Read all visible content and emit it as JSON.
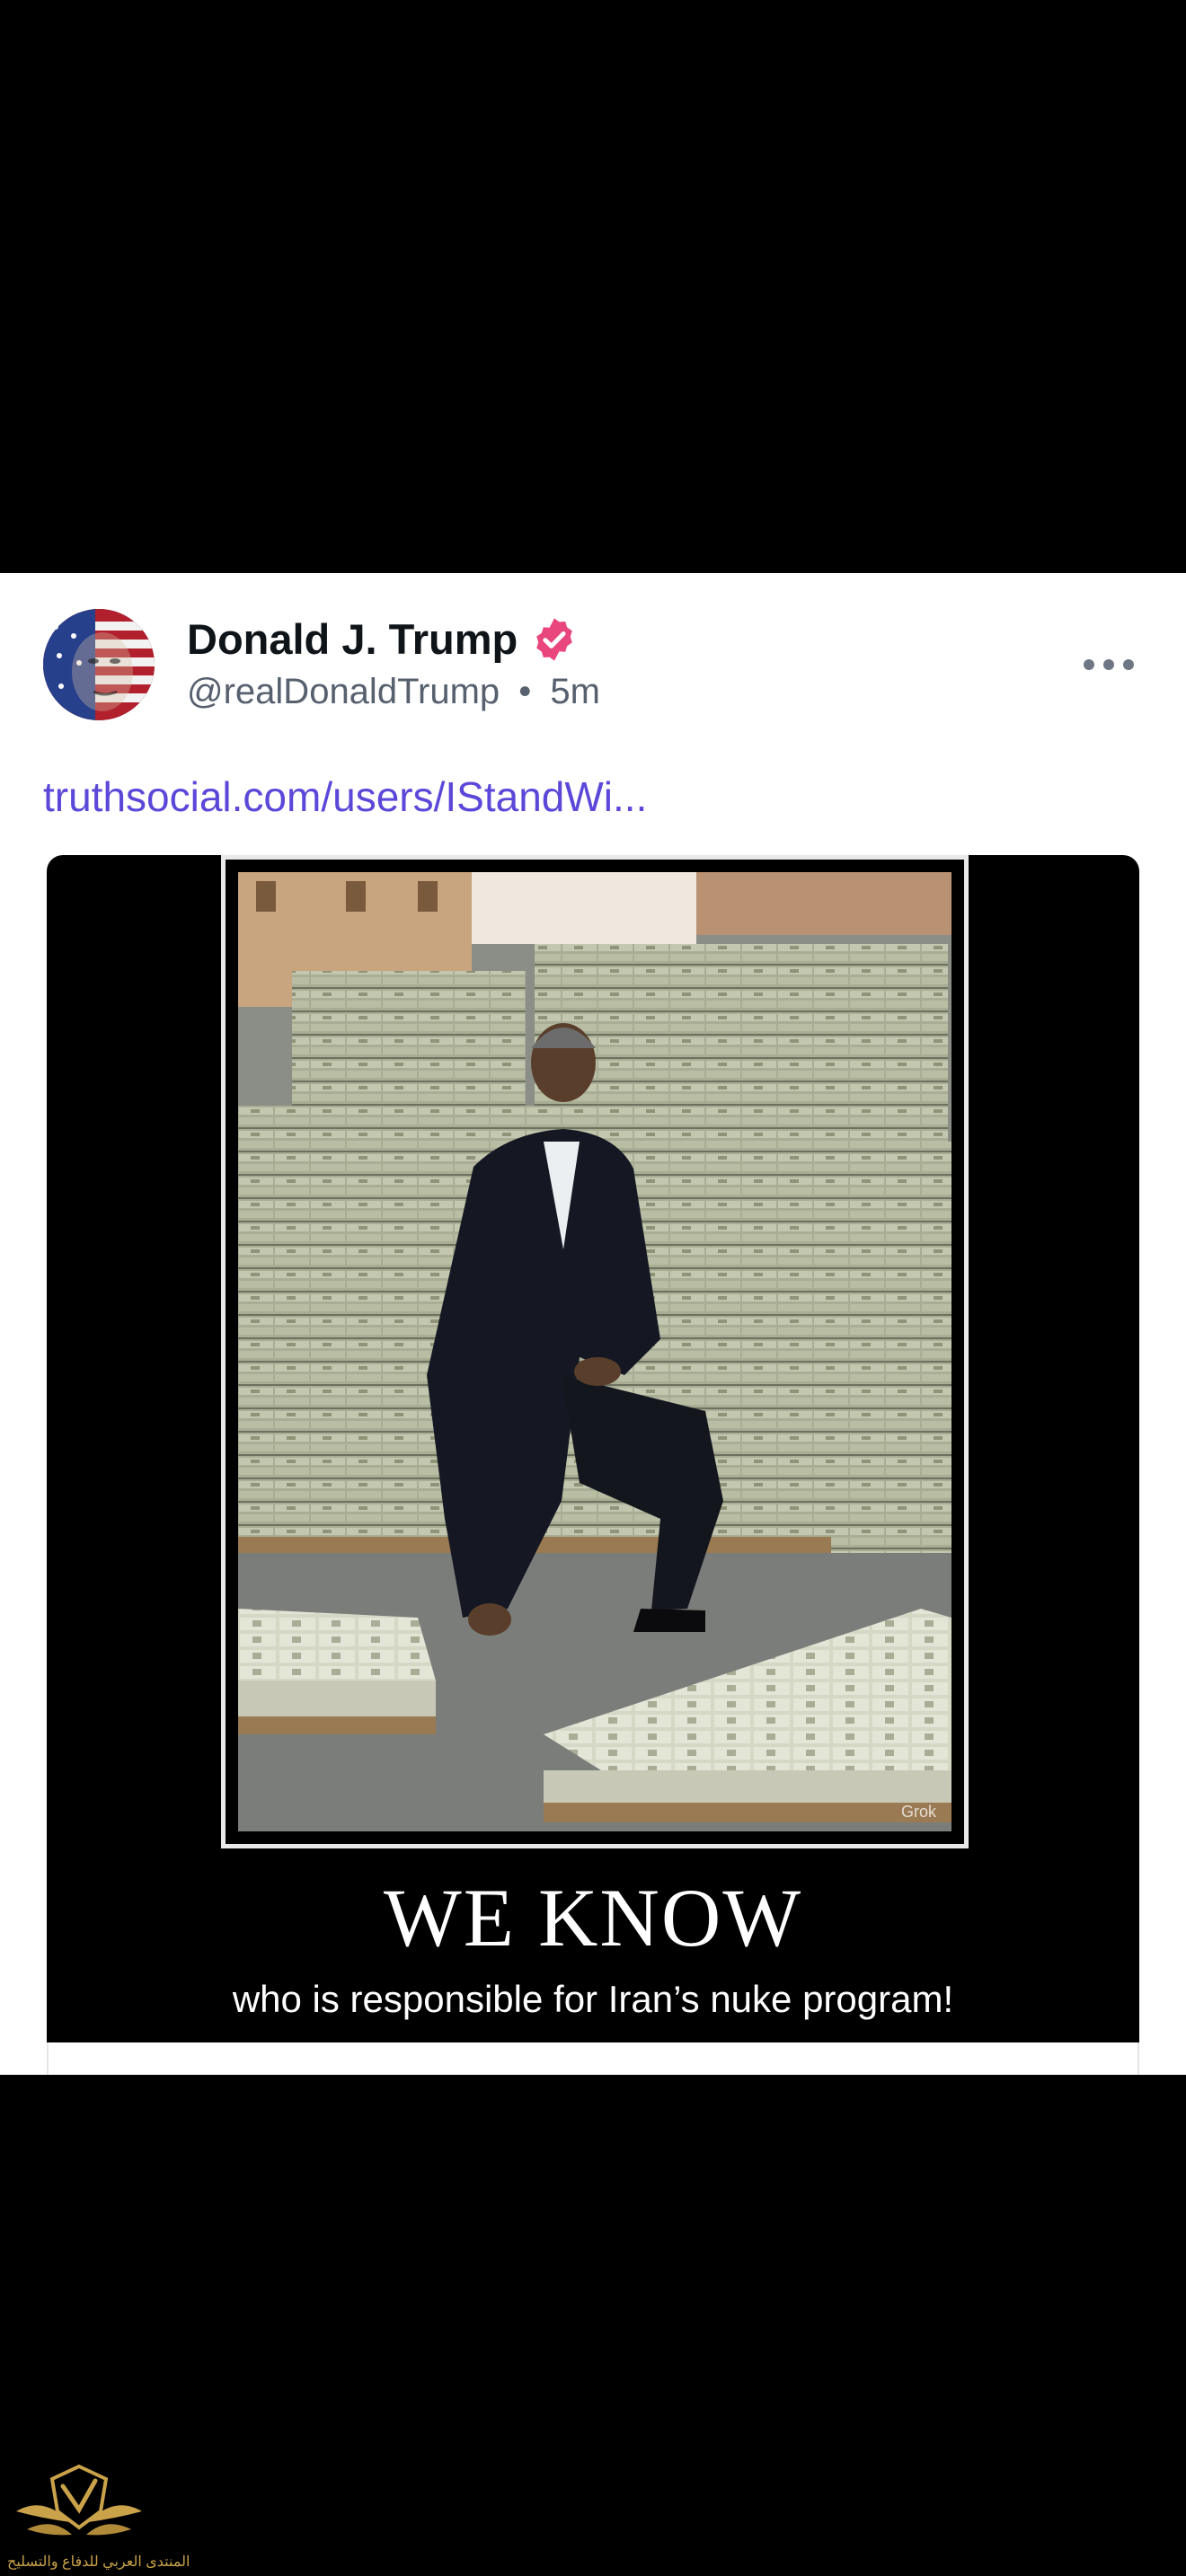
{
  "post": {
    "author_name": "Donald J. Trump",
    "handle": "@realDonaldTrump",
    "separator": "•",
    "time": "5m",
    "link_text": "truthsocial.com/users/IStandWi...",
    "verified_color": "#e8467c",
    "link_color": "#5b48d9"
  },
  "media": {
    "headline": "WE KNOW",
    "caption": "who is responsible for Iran’s nuke program!",
    "watermark_brand": "Grok"
  },
  "watermark": {
    "text": "المنتدى العربي للدفاع والتسليح"
  }
}
